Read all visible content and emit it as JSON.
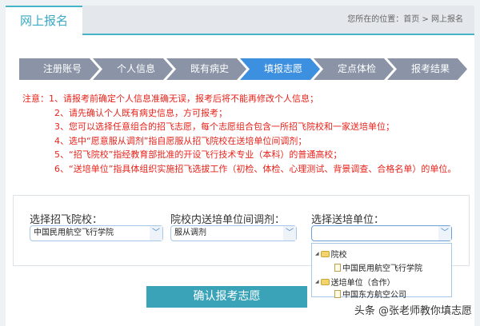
{
  "tab": "网上报名",
  "breadcrumb": "您所在的位置：首页 > 网上报名",
  "steps": [
    "注册账号",
    "个人信息",
    "既有病史",
    "填报志愿",
    "定点体检",
    "报考结果"
  ],
  "active_step": 3,
  "notes": [
    "注意：1、请报考前确定个人信息准确无误，报考后将不能再修改个人信息；",
    "2、请先确认个人既有病史信息，方可报考；",
    "3、您可以选择任意组合的招飞志愿，每个志愿组合包含一所招飞院校和一家送培单位；",
    "4、选中“愿意服从调剂”指自愿服从招飞院校在送培单位间调剂；",
    "5、“招飞院校”指经教育部批准的开设飞行技术专业（本科）的普通高校；",
    "6、“送培单位”指具体组织实施招飞选拔工作（初检、体检、心理测试、背景调查、合格名单）的单位。"
  ],
  "form": {
    "school_label": "选择招飞院校：",
    "school_value": "中国民用航空飞行学院",
    "adjust_label": "院校内送培单位间调剂：",
    "adjust_value": "服从调剂",
    "unit_label": "选择送培单位：",
    "unit_value": ""
  },
  "dropdown": {
    "group1": "院校",
    "item1": "中国民用航空飞行学院",
    "group2": "送培单位（合作）",
    "item2": "中国东方航空公司"
  },
  "confirm": "确认报考志愿",
  "watermark": "头条 @张老师教你填志愿"
}
